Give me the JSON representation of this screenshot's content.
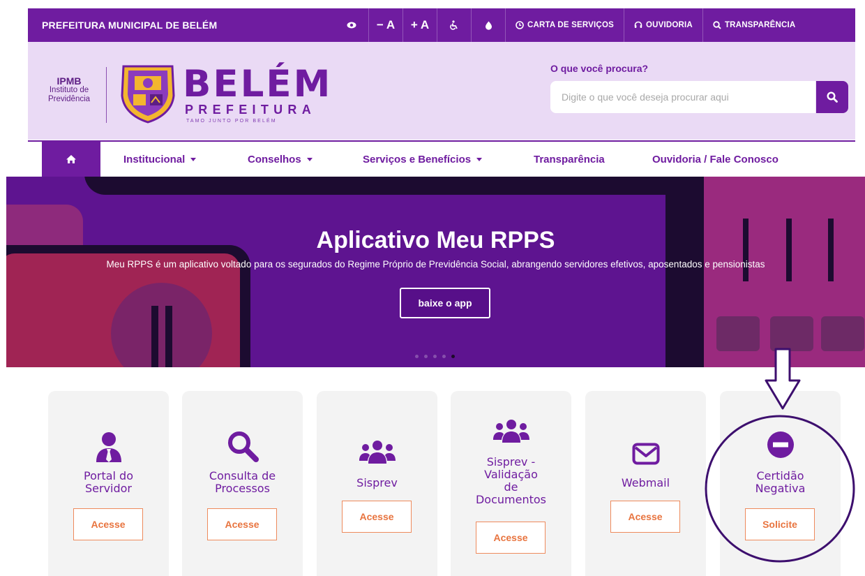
{
  "topbar": {
    "brand": "PREFEITURA MUNICIPAL DE BELÉM",
    "decrease_font": "− A",
    "increase_font": "+ A",
    "links": {
      "carta": "CARTA DE SERVIÇOS",
      "ouvidoria": "OUVIDORIA",
      "transparencia": "TRANSPARÊNCIA"
    },
    "icons": [
      "eye-icon",
      "accessibility-icon",
      "contrast-icon",
      "clock-icon",
      "headset-icon",
      "search-icon"
    ]
  },
  "header": {
    "ipmb_title": "IPMB",
    "ipmb_line1": "Instituto de",
    "ipmb_line2": "Previdência",
    "logo_main": "BELÉM",
    "logo_sub": "PREFEITURA",
    "logo_tagline": "TAMO JUNTO POR BELÉM",
    "search_label": "O que você procura?",
    "search_placeholder": "Digite o que você deseja procurar aqui"
  },
  "nav": {
    "items": [
      {
        "label": "Institucional"
      },
      {
        "label": "Conselhos"
      },
      {
        "label": "Serviços e Benefícios"
      },
      {
        "label": "Transparência"
      },
      {
        "label": "Ouvidoria / Fale Conosco"
      }
    ]
  },
  "hero": {
    "title": "Aplicativo Meu RPPS",
    "subtitle": "Meu RPPS é um aplicativo voltado para os segurados do Regime Próprio de Previdência Social, abrangendo servidores efetivos, aposentados e pensionistas",
    "button": "baixe o app",
    "slides": 5,
    "active_slide": 5
  },
  "cards": [
    {
      "title_1": "Portal do",
      "title_2": "Servidor",
      "button": "Acesse",
      "icon": "user-tie-icon"
    },
    {
      "title_1": "Consulta de",
      "title_2": "Processos",
      "button": "Acesse",
      "icon": "search-icon"
    },
    {
      "title_1": "Sisprev",
      "button": "Acesse",
      "icon": "users-icon"
    },
    {
      "title_1": "Sisprev -",
      "title_2": "Validação",
      "title_3": "de",
      "title_4": "Documentos",
      "button": "Acesse",
      "icon": "users-icon"
    },
    {
      "title_1": "Webmail",
      "button": "Acesse",
      "icon": "envelope-icon"
    },
    {
      "title_1": "Certidão",
      "title_2": "Negativa",
      "button": "Solicite",
      "icon": "minus-circle-icon"
    }
  ],
  "colors": {
    "primary": "#6f1ca0",
    "header_bg": "#eadaf5",
    "accent_orange": "#e8743f",
    "annotation": "#3d0f6e"
  }
}
